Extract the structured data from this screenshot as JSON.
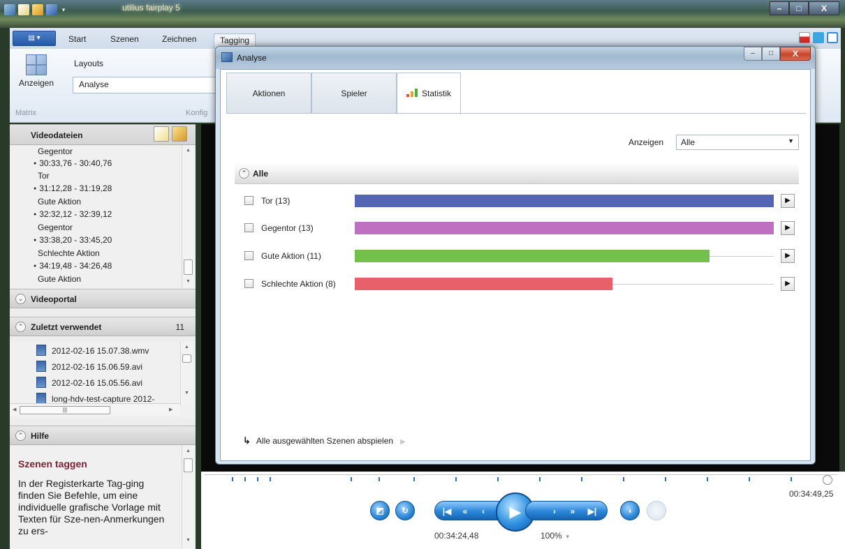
{
  "window": {
    "title": "utilius fairplay 5",
    "minimize": "–",
    "maximize": "□",
    "close": "X"
  },
  "ribbon": {
    "file_label": "▤ ▾",
    "tabs": [
      "Start",
      "Szenen",
      "Zeichnen",
      "Tagging"
    ],
    "active_tab": "Tagging",
    "anzeigen_label": "Anzeigen",
    "group_matrix": "Matrix",
    "group_konfig": "Konfig",
    "layouts_label": "Layouts",
    "layouts_value": "Analyse"
  },
  "left_panel": {
    "videodateien": {
      "title": "Videodateien",
      "rows": [
        {
          "kind": "label",
          "text": "Gegentor"
        },
        {
          "kind": "time",
          "text": "30:33,76 - 30:40,76"
        },
        {
          "kind": "label",
          "text": "Tor"
        },
        {
          "kind": "time",
          "text": "31:12,28 - 31:19,28"
        },
        {
          "kind": "label",
          "text": "Gute Aktion"
        },
        {
          "kind": "time",
          "text": "32:32,12 - 32:39,12"
        },
        {
          "kind": "label",
          "text": "Gegentor"
        },
        {
          "kind": "time",
          "text": "33:38,20 - 33:45,20"
        },
        {
          "kind": "label",
          "text": "Schlechte Aktion"
        },
        {
          "kind": "time",
          "text": "34:19,48 - 34:26,48"
        },
        {
          "kind": "label",
          "text": "Gute Aktion"
        }
      ]
    },
    "videoportal": {
      "title": "Videoportal"
    },
    "zuletzt": {
      "title": "Zuletzt verwendet",
      "count": "11",
      "files": [
        "2012-02-16 15.07.38.wmv",
        "2012-02-16 15.06.59.avi",
        "2012-02-16 15.05.56.avi",
        "long-hdv-test-capture 2012-"
      ]
    },
    "hilfe": {
      "title": "Hilfe",
      "heading": "Szenen taggen",
      "text": "In der Registerkarte Tag-ging finden Sie Befehle, um eine individuelle grafische Vorlage mit Texten für Sze-nen-Anmerkungen zu ers-"
    }
  },
  "player": {
    "current_time": "00:34:24,48",
    "total_time": "00:34:49,25",
    "zoom": "100%"
  },
  "dialog": {
    "title": "Analyse",
    "tabs": [
      "Aktionen",
      "Spieler",
      "Statistik"
    ],
    "active_tab": "Statistik",
    "anzeigen_label": "Anzeigen",
    "anzeigen_value": "Alle",
    "group_title": "Alle",
    "stats": [
      {
        "label": "Tor (13)",
        "value": 13,
        "color": "#5465b4"
      },
      {
        "label": "Gegentor (13)",
        "value": 13,
        "color": "#c070c0"
      },
      {
        "label": "Gute Aktion (11)",
        "value": 11,
        "color": "#74c04c"
      },
      {
        "label": "Schlechte Aktion (8)",
        "value": 8,
        "color": "#e8606a"
      }
    ],
    "max_value": 13,
    "play_all_label": "Alle ausgewählten Szenen abspielen"
  }
}
